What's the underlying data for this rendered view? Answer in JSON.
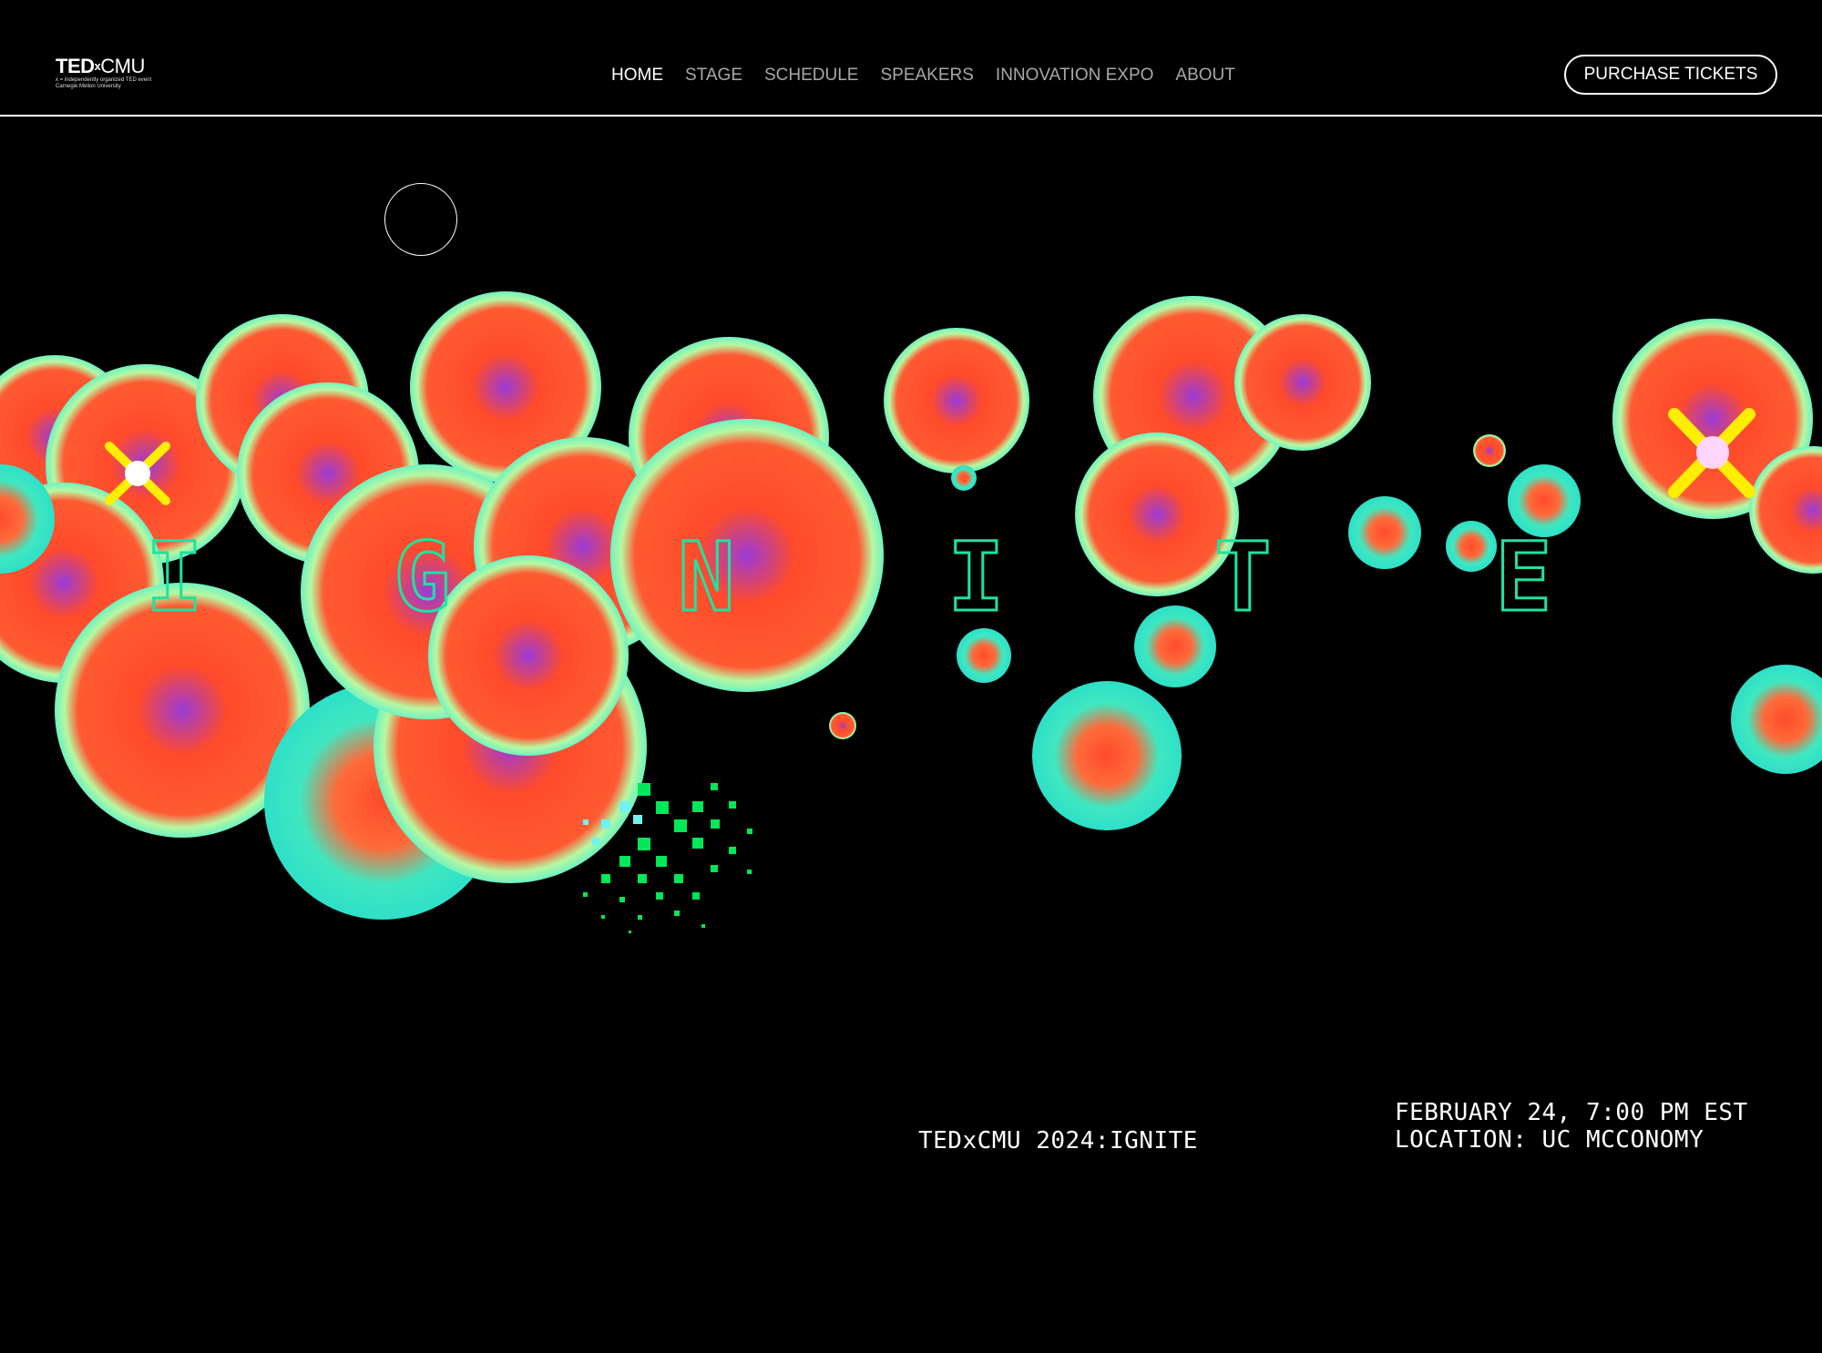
{
  "header": {
    "logo": {
      "ted": "TED",
      "x": "x",
      "cmu": "CMU",
      "sub1": "x = independently organized TED event",
      "sub2": "Carnegie Mellon University"
    },
    "nav": [
      {
        "label": "HOME",
        "active": true
      },
      {
        "label": "STAGE",
        "active": false
      },
      {
        "label": "SCHEDULE",
        "active": false
      },
      {
        "label": "SPEAKERS",
        "active": false
      },
      {
        "label": "INNOVATION EXPO",
        "active": false
      },
      {
        "label": "ABOUT",
        "active": false
      }
    ],
    "cta_label": "PURCHASE TICKETS"
  },
  "hero": {
    "letters": [
      "I",
      "G",
      "N",
      "I",
      "T",
      "E"
    ],
    "event_title": "TEDxCMU 2024:IGNITE",
    "date_line": "FEBRUARY 24, 7:00 PM EST",
    "location_line": "LOCATION: UC MCCONOMY"
  },
  "colors": {
    "accent": "#1de3a0",
    "flower_orange": "#ff4b2b",
    "flower_edge": "#7dffb0",
    "flower_vein": "#8a2be2",
    "sparkle": "#ffee00",
    "pixel_green": "#00e85a"
  }
}
